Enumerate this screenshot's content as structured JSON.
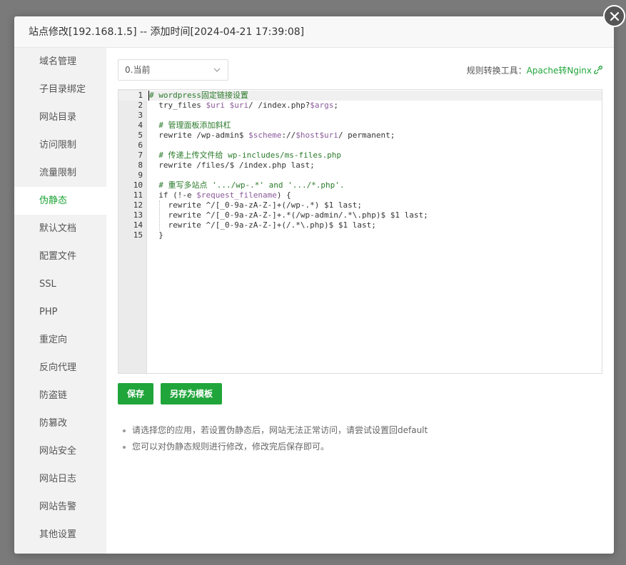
{
  "modal": {
    "title": "站点修改[192.168.1.5] -- 添加时间[2024-04-21 17:39:08]"
  },
  "sidebar": {
    "items": [
      {
        "label": "域名管理"
      },
      {
        "label": "子目录绑定"
      },
      {
        "label": "网站目录"
      },
      {
        "label": "访问限制"
      },
      {
        "label": "流量限制"
      },
      {
        "label": "伪静态",
        "active": true
      },
      {
        "label": "默认文档"
      },
      {
        "label": "配置文件"
      },
      {
        "label": "SSL"
      },
      {
        "label": "PHP"
      },
      {
        "label": "重定向"
      },
      {
        "label": "反向代理"
      },
      {
        "label": "防盗链"
      },
      {
        "label": "防篡改"
      },
      {
        "label": "网站安全"
      },
      {
        "label": "网站日志"
      },
      {
        "label": "网站告警"
      },
      {
        "label": "其他设置"
      }
    ]
  },
  "rewrite": {
    "template_select": "0.当前",
    "tool_label": "规则转换工具：",
    "tool_link": "Apache转Nginx",
    "save_label": "保存",
    "save_as_template_label": "另存为模板"
  },
  "editor": {
    "lines": [
      "# wordpress固定链接设置",
      "  try_files $uri $uri/ /index.php?$args;",
      "",
      "  # 管理面板添加斜杠",
      "  rewrite /wp-admin$ $scheme://$host$uri/ permanent;",
      "",
      "  # 传递上传文件给 wp-includes/ms-files.php",
      "  rewrite /files/$ /index.php last;",
      "",
      "  # 重写多站点 '.../wp-.*' and '.../*.php'.",
      "  if (!-e $request_filename) {",
      "    rewrite ^/[_0-9a-zA-Z-]+(/wp-.*) $1 last;",
      "    rewrite ^/[_0-9a-zA-Z-]+.*(/wp-admin/.*\\.php)$ $1 last;",
      "    rewrite ^/[_0-9a-zA-Z-]+(/.*\\.php)$ $1 last;",
      "  }"
    ]
  },
  "tips": [
    "请选择您的应用，若设置伪静态后，网站无法正常访问，请尝试设置回default",
    "您可以对伪静态规则进行修改，修改完后保存即可。"
  ],
  "colors": {
    "accent": "#20a53a",
    "sidebar_bg": "#f2f2f2",
    "overlay": "#7a7a7a"
  },
  "icons": {
    "close": "close-icon",
    "dropdown": "chevron-down-icon",
    "link": "link-icon"
  }
}
